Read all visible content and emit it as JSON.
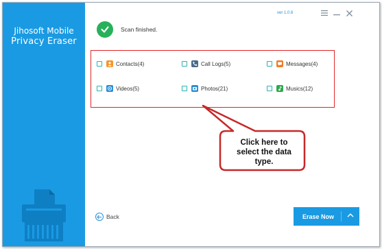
{
  "app": {
    "name_line1": "Jihosoft Mobile",
    "name_line2": "Privacy Eraser",
    "version": "ver 1.0.6"
  },
  "titlebar": {
    "menu_icon": "hamburger-icon",
    "minimize_icon": "minimize-icon",
    "close_icon": "close-icon"
  },
  "status": {
    "icon": "check-circle-icon",
    "text": "Scan finished."
  },
  "data_types": [
    {
      "label": "Contacts(4)",
      "icon": "contacts-icon",
      "color": "#f5962a",
      "checked": false
    },
    {
      "label": "Call Logs(5)",
      "icon": "phone-icon",
      "color": "#4a6a8a",
      "checked": false
    },
    {
      "label": "Messages(4)",
      "icon": "message-icon",
      "color": "#f07b24",
      "checked": false
    },
    {
      "label": "Videos(5)",
      "icon": "video-icon",
      "color": "#2b8fd8",
      "checked": false
    },
    {
      "label": "Photos(21)",
      "icon": "photo-icon",
      "color": "#2b8fd8",
      "checked": false
    },
    {
      "label": "Musics(12)",
      "icon": "music-icon",
      "color": "#2fa84f",
      "checked": false
    }
  ],
  "callout": {
    "line1": "Click here to",
    "line2": "select the data",
    "line3": "type."
  },
  "footer": {
    "back_label": "Back",
    "erase_label": "Erase Now"
  },
  "colors": {
    "sidebar": "#1a9ae3",
    "accent": "#1a9ae3",
    "success": "#27b15a",
    "highlight_border": "#e02424"
  }
}
